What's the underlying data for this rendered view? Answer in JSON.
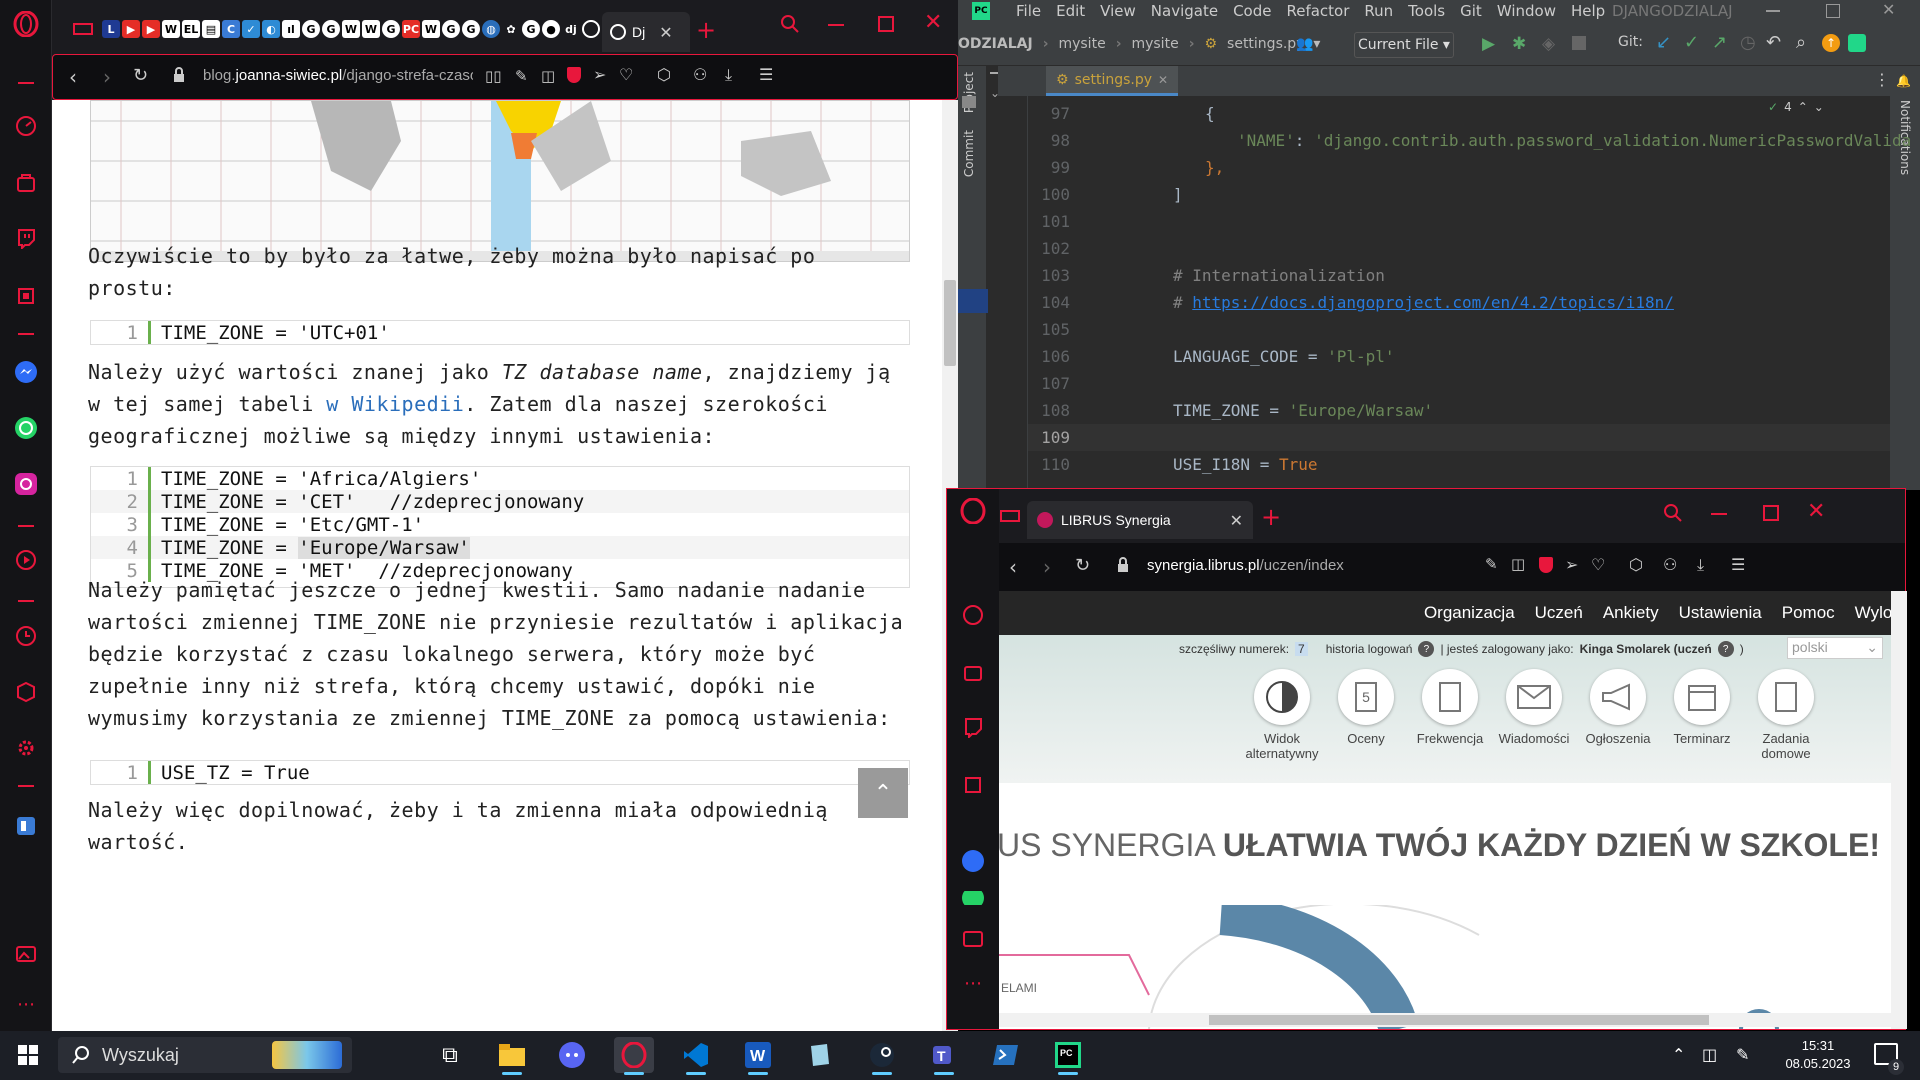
{
  "left_browser": {
    "active_tab_label": "Dj",
    "url_prefix": "blog.",
    "url_domain": "joanna-siwiec.pl",
    "url_path": "/django-strefa-czasowa/",
    "paragraphs": {
      "p1": "Oczywiście to by było za łatwe, żeby można było napisać po prostu:",
      "p2_a": "Należy użyć wartości znanej jako ",
      "p2_em": "TZ database name",
      "p2_b": ", znajdziemy ją w tej samej tabeli ",
      "p2_link": "w Wikipedii",
      "p2_c": ". Zatem dla naszej szerokości geograficznej możliwe są między innymi ustawienia:",
      "p3": "Należy pamiętać jeszcze o jednej kwestii. Samo nadanie nadanie wartości zmiennej TIME_ZONE nie przyniesie rezultatów i aplikacja będzie korzystać z czasu lokalnego serwera, który może być zupełnie inny niż strefa, którą chcemy ustawić, dopóki nie wymusimy korzystania ze zmiennej TIME_ZONE za pomocą ustawienia:",
      "p4": "Należy więc dopilnować, żeby i ta zmienna miała odpowiednią wartość."
    },
    "code1": [
      {
        "n": "1",
        "code": "TIME_ZONE = 'UTC+01'"
      }
    ],
    "code2": [
      {
        "n": "1",
        "code": "TIME_ZONE = 'Africa/Algiers'"
      },
      {
        "n": "2",
        "code": "TIME_ZONE = 'CET'   //zdeprecjonowany"
      },
      {
        "n": "3",
        "code": "TIME_ZONE = 'Etc/GMT-1'"
      },
      {
        "n": "4",
        "code": "TIME_ZONE = ",
        "highlight": "'Europe/Warsaw'"
      },
      {
        "n": "5",
        "code": "TIME_ZONE = 'MET'  //zdeprecjonowany"
      }
    ],
    "code3": [
      {
        "n": "1",
        "code": "USE_TZ = True"
      }
    ]
  },
  "pycharm": {
    "menu": [
      "File",
      "Edit",
      "View",
      "Navigate",
      "Code",
      "Refactor",
      "Run",
      "Tools",
      "Git",
      "Window",
      "Help"
    ],
    "project_title": "DJANGODZIALAJ",
    "breadcrumbs": [
      "ODZIALAJ",
      "mysite",
      "mysite",
      "settings.py"
    ],
    "run_config": "Current File",
    "git_label": "Git:",
    "tab": "settings.py",
    "side_project": "Project",
    "side_commit": "Commit",
    "side_notifications": "Notifications",
    "inspection_count": "4",
    "lines": [
      {
        "n": "97",
        "parts": [
          {
            "t": "{",
            "c": ""
          }
        ],
        "indent": 2
      },
      {
        "n": "98",
        "parts": [
          {
            "t": "'NAME'",
            "c": "str"
          },
          {
            "t": ": ",
            "c": ""
          },
          {
            "t": "'django.contrib.auth.password_validation.NumericPasswordValida",
            "c": "str"
          }
        ],
        "indent": 4
      },
      {
        "n": "99",
        "parts": [
          {
            "t": "},",
            "c": "kw"
          }
        ],
        "indent": 2
      },
      {
        "n": "100",
        "parts": [
          {
            "t": "]",
            "c": ""
          }
        ],
        "indent": 0
      },
      {
        "n": "101",
        "parts": [],
        "indent": 0
      },
      {
        "n": "102",
        "parts": [],
        "indent": 0
      },
      {
        "n": "103",
        "parts": [
          {
            "t": "# Internationalization",
            "c": "com"
          }
        ],
        "indent": 0
      },
      {
        "n": "104",
        "parts": [
          {
            "t": "# ",
            "c": "com"
          },
          {
            "t": "https://docs.djangoproject.com/en/4.2/topics/i18n/",
            "c": "lnk"
          }
        ],
        "indent": 0
      },
      {
        "n": "105",
        "parts": [],
        "indent": 0
      },
      {
        "n": "106",
        "parts": [
          {
            "t": "LANGUAGE_CODE = ",
            "c": ""
          },
          {
            "t": "'Pl-pl'",
            "c": "str"
          }
        ],
        "indent": 0
      },
      {
        "n": "107",
        "parts": [],
        "indent": 0
      },
      {
        "n": "108",
        "parts": [
          {
            "t": "TIME_ZONE = ",
            "c": ""
          },
          {
            "t": "'Europe/Warsaw'",
            "c": "str"
          }
        ],
        "indent": 0
      },
      {
        "n": "109",
        "parts": [],
        "indent": 0
      },
      {
        "n": "110",
        "parts": [
          {
            "t": "USE_I18N = ",
            "c": ""
          },
          {
            "t": "True",
            "c": "kw"
          }
        ],
        "indent": 0
      }
    ]
  },
  "librus_browser": {
    "tab_label": "LIBRUS Synergia",
    "url_domain": "synergia.librus.pl",
    "url_path": "/uczen/index",
    "nav": [
      "Organizacja",
      "Uczeń",
      "Ankiety",
      "Ustawienia",
      "Pomoc",
      "Wyloguj"
    ],
    "lucky_label": "szczęśliwy numerek:",
    "lucky_number": "7",
    "history_label": "historia logowań",
    "logged_label": "| jesteś zalogowany jako:",
    "logged_user": "Kinga Smolarek (uczeń",
    "logged_close": ")",
    "language": "polski",
    "icons": [
      {
        "label": "Widok alternatywny",
        "icon": "half-circle-icon"
      },
      {
        "label": "Oceny",
        "icon": "grades-icon",
        "glyph": "5"
      },
      {
        "label": "Frekwencja",
        "icon": "attendance-icon"
      },
      {
        "label": "Wiadomości",
        "icon": "envelope-icon"
      },
      {
        "label": "Ogłoszenia",
        "icon": "megaphone-icon"
      },
      {
        "label": "Terminarz",
        "icon": "calendar-icon"
      },
      {
        "label": "Zadania domowe",
        "icon": "homework-icon"
      }
    ],
    "banner_light": "US SYNERGIA ",
    "banner_bold": "UŁATWIA TWÓJ KAŻDY DZIEŃ W SZKOLE!",
    "bottom_text": "ELAMI"
  },
  "taskbar": {
    "search_placeholder": "Wyszukaj",
    "time": "15:31",
    "date": "08.05.2023",
    "notification_count": "9"
  },
  "colors": {
    "opera_red": "#e8173c",
    "pycharm_bg": "#2b2b2b",
    "taskbar": "#1c1f26"
  }
}
